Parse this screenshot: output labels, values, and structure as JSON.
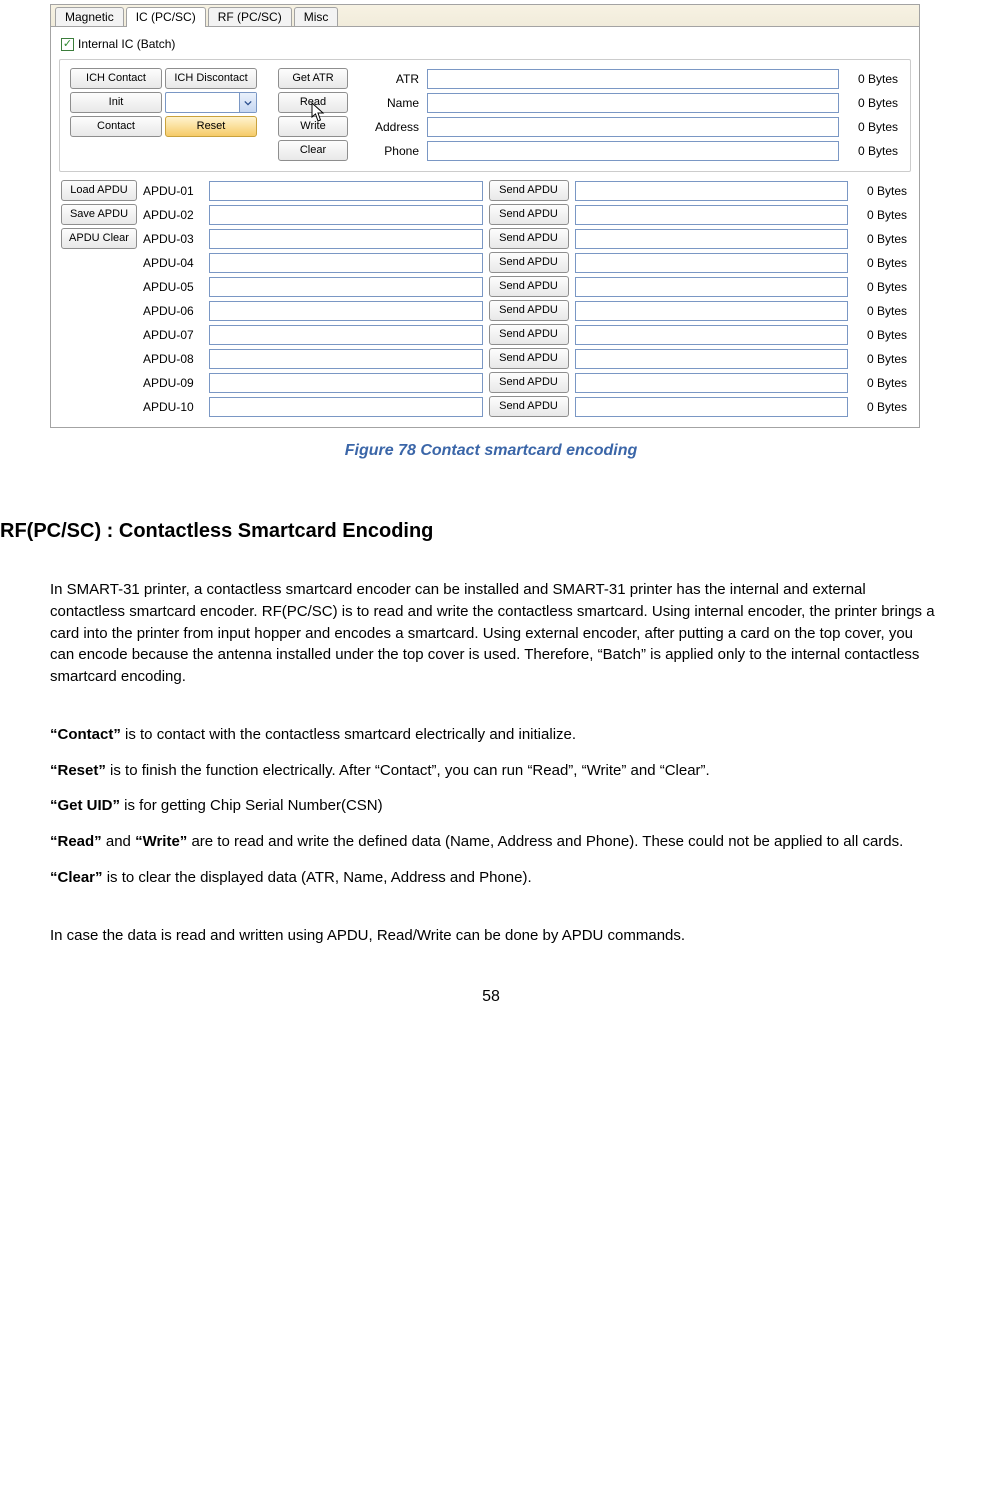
{
  "tabs": [
    "Magnetic",
    "IC (PC/SC)",
    "RF (PC/SC)",
    "Misc"
  ],
  "active_tab_index": 1,
  "checkbox": {
    "label": "Internal IC (Batch)",
    "checked": true
  },
  "left_buttons": {
    "r0c0": "ICH Contact",
    "r0c1": "ICH Discontact",
    "r1c0": "Init",
    "r2c0": "Contact",
    "r2c1": "Reset"
  },
  "mid_buttons": [
    "Get ATR",
    "Read",
    "Write",
    "Clear"
  ],
  "fields": [
    {
      "label": "ATR",
      "bytes": "0 Bytes"
    },
    {
      "label": "Name",
      "bytes": "0 Bytes"
    },
    {
      "label": "Address",
      "bytes": "0 Bytes"
    },
    {
      "label": "Phone",
      "bytes": "0 Bytes"
    }
  ],
  "apdu_left_buttons": [
    "Load APDU",
    "Save APDU",
    "APDU Clear"
  ],
  "apdu_rows": [
    {
      "label": "APDU-01",
      "send": "Send APDU",
      "bytes": "0 Bytes"
    },
    {
      "label": "APDU-02",
      "send": "Send APDU",
      "bytes": "0 Bytes"
    },
    {
      "label": "APDU-03",
      "send": "Send APDU",
      "bytes": "0 Bytes"
    },
    {
      "label": "APDU-04",
      "send": "Send APDU",
      "bytes": "0 Bytes"
    },
    {
      "label": "APDU-05",
      "send": "Send APDU",
      "bytes": "0 Bytes"
    },
    {
      "label": "APDU-06",
      "send": "Send APDU",
      "bytes": "0 Bytes"
    },
    {
      "label": "APDU-07",
      "send": "Send APDU",
      "bytes": "0 Bytes"
    },
    {
      "label": "APDU-08",
      "send": "Send APDU",
      "bytes": "0 Bytes"
    },
    {
      "label": "APDU-09",
      "send": "Send APDU",
      "bytes": "0 Bytes"
    },
    {
      "label": "APDU-10",
      "send": "Send APDU",
      "bytes": "0 Bytes"
    }
  ],
  "caption": "Figure 78 Contact smartcard encoding",
  "section_heading": "RF(PC/SC) : Contactless Smartcard Encoding",
  "para_intro": "In SMART-31 printer, a contactless smartcard encoder can be installed and SMART-31 printer has the internal and external contactless smartcard encoder. RF(PC/SC) is to read and write the contactless smartcard. Using internal encoder, the printer brings a card into the printer from input hopper and encodes a smartcard. Using external encoder, after putting a card on the top cover, you can encode because the antenna installed under the top cover is used. Therefore, “Batch” is applied only to the internal contactless smartcard encoding.",
  "defs": {
    "contact_b": "“Contact”",
    "contact_t": " is to contact with the contactless smartcard electrically and initialize.",
    "reset_b": "“Reset”",
    "reset_t": " is to finish the function electrically. After “Contact”, you can run “Read”, “Write” and “Clear”.",
    "getuid_b": "“Get UID”",
    "getuid_t": " is for getting Chip Serial Number(CSN)",
    "read_b": "“Read”",
    "and_t": " and ",
    "write_b": "“Write”",
    "rw_t": " are to read and write the defined data (Name, Address and Phone). These could not be applied to all cards.",
    "clear_b": "“Clear”",
    "clear_t": " is to clear the displayed data (ATR, Name, Address and Phone)."
  },
  "para_apdu": "In case the data is read and written using APDU, Read/Write can be done by APDU commands.",
  "page_number": "58"
}
